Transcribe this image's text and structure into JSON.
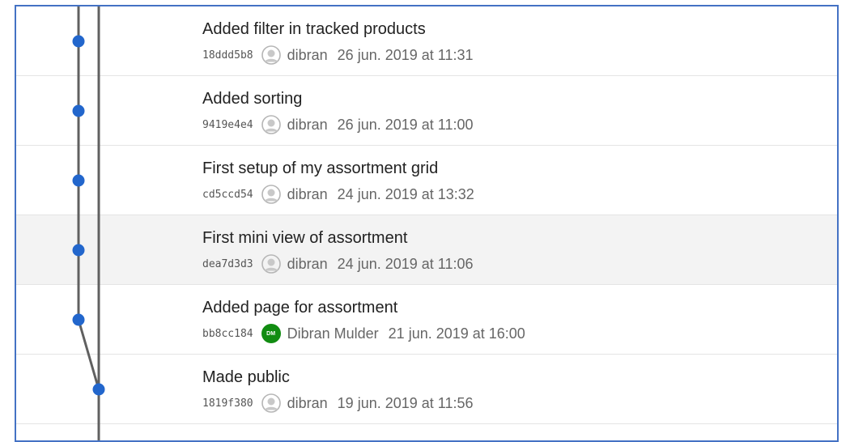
{
  "theme": {
    "accent": "#4472c4",
    "node_color": "#2266cc",
    "line_color": "#606060",
    "avatar_green": "#118c11"
  },
  "commits": [
    {
      "message": "Added filter in tracked products",
      "hash": "18ddd5b8",
      "author": "dibran",
      "date": "26 jun. 2019 at 11:31",
      "avatar": "person-icon",
      "selected": false
    },
    {
      "message": "Added sorting",
      "hash": "9419e4e4",
      "author": "dibran",
      "date": "26 jun. 2019 at 11:00",
      "avatar": "person-icon",
      "selected": false
    },
    {
      "message": "First setup of my assortment grid",
      "hash": "cd5ccd54",
      "author": "dibran",
      "date": "24 jun. 2019 at 13:32",
      "avatar": "person-icon",
      "selected": false
    },
    {
      "message": "First mini view of assortment",
      "hash": "dea7d3d3",
      "author": "dibran",
      "date": "24 jun. 2019 at 11:06",
      "avatar": "person-icon",
      "selected": true
    },
    {
      "message": "Added page for assortment",
      "hash": "bb8cc184",
      "author": "Dibran Mulder",
      "date": "21 jun. 2019 at 16:00",
      "avatar": "initials-avatar",
      "avatar_initials": "DM",
      "selected": false
    },
    {
      "message": "Made public",
      "hash": "1819f380",
      "author": "dibran",
      "date": "19 jun. 2019 at 11:56",
      "avatar": "person-icon",
      "selected": false
    }
  ]
}
